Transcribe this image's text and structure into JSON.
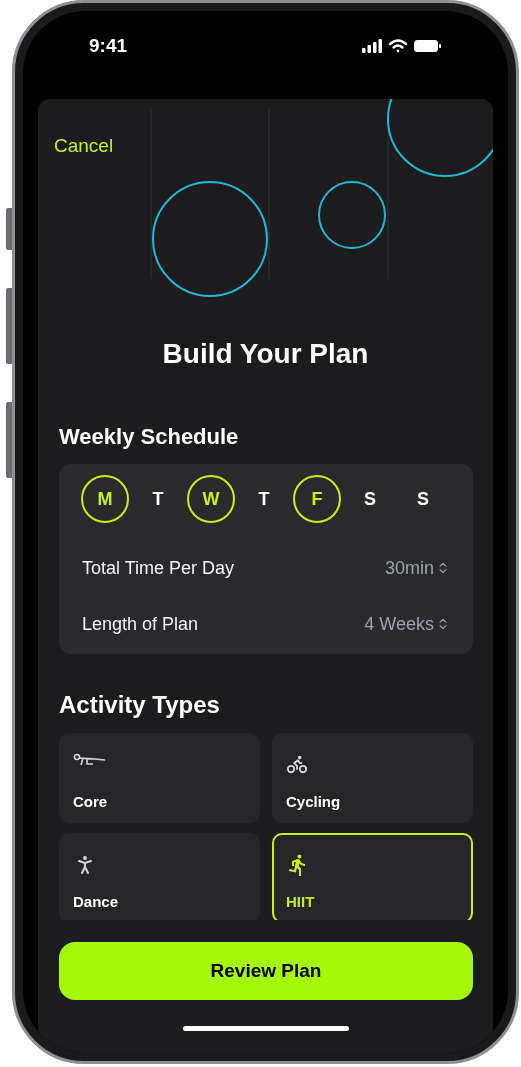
{
  "status_bar": {
    "time": "9:41"
  },
  "cancel": "Cancel",
  "title": "Build Your Plan",
  "weekly_schedule": {
    "heading": "Weekly Schedule",
    "days": [
      {
        "label": "M",
        "selected": true
      },
      {
        "label": "T",
        "selected": false
      },
      {
        "label": "W",
        "selected": true
      },
      {
        "label": "T",
        "selected": false
      },
      {
        "label": "F",
        "selected": true
      },
      {
        "label": "S",
        "selected": false
      },
      {
        "label": "S",
        "selected": false
      }
    ],
    "rows": [
      {
        "label": "Total Time Per Day",
        "value": "30min"
      },
      {
        "label": "Length of Plan",
        "value": "4 Weeks"
      }
    ]
  },
  "activity_types": {
    "heading": "Activity Types",
    "items": [
      {
        "label": "Core",
        "kind": "core",
        "selected": false
      },
      {
        "label": "Cycling",
        "kind": "cycling",
        "selected": false
      },
      {
        "label": "Dance",
        "kind": "dance",
        "selected": false
      },
      {
        "label": "HIIT",
        "kind": "hiit",
        "selected": true
      }
    ]
  },
  "button": "Review Plan"
}
